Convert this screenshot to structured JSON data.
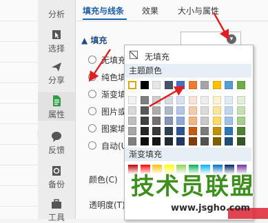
{
  "tabs": [
    {
      "label": "填充与线条",
      "active": true
    },
    {
      "label": "效果",
      "active": false
    },
    {
      "label": "大小与属性",
      "active": false
    }
  ],
  "sidebar": {
    "items": [
      {
        "label": "分析",
        "icon": "analysis-icon"
      },
      {
        "label": "选择",
        "icon": "select-cursor-icon"
      },
      {
        "label": "分享",
        "icon": "share-icon"
      },
      {
        "label": "属性",
        "icon": "properties-icon",
        "active": true
      },
      {
        "label": "反馈",
        "icon": "feedback-icon"
      },
      {
        "label": "备份",
        "icon": "backup-icon"
      },
      {
        "label": "工具",
        "icon": "toolbox-icon"
      }
    ]
  },
  "fill": {
    "section_title": "▲ 填充",
    "options": [
      {
        "label": "无填充",
        "checked": false
      },
      {
        "label": "纯色填充",
        "checked": true
      },
      {
        "label": "渐变填充",
        "checked": false
      },
      {
        "label": "图片或纹理填充",
        "checked": false
      },
      {
        "label": "图案填充",
        "checked": false
      },
      {
        "label": "自动(U)",
        "checked": false
      }
    ],
    "color_label": "颜色(C)",
    "transparency_label": "透明度(T)"
  },
  "palette": {
    "no_fill_label": "无填充",
    "theme_colors_label": "主题颜色",
    "gradient_label": "渐变填充",
    "theme_top_row": [
      "#ffffff",
      "#000000",
      "#e7e6e6",
      "#44546a",
      "#4472c4",
      "#ed7d31",
      "#a5a5a5",
      "#ffc000",
      "#5b9bd5",
      "#70ad47"
    ],
    "theme_shades": [
      [
        "#f2f2f2",
        "#7f7f7f",
        "#d0cece",
        "#d6dce4",
        "#d9e2f3",
        "#fbe4d5",
        "#ededed",
        "#fff2cc",
        "#deebf6",
        "#e2efd9"
      ],
      [
        "#d9d9d9",
        "#595959",
        "#aeabab",
        "#adb9ca",
        "#b4c6e7",
        "#f7caac",
        "#dbdbdb",
        "#fee599",
        "#bdd7ee",
        "#c5e0b3"
      ],
      [
        "#bfbfbf",
        "#404040",
        "#757070",
        "#8496b0",
        "#8eaadb",
        "#f4b183",
        "#c9c9c9",
        "#ffd965",
        "#9cc3e5",
        "#a8d08d"
      ],
      [
        "#a6a6a6",
        "#262626",
        "#3a3838",
        "#323f4f",
        "#2f5496",
        "#c55a11",
        "#7b7b7b",
        "#bf9000",
        "#2e75b5",
        "#538135"
      ],
      [
        "#808080",
        "#0d0d0d",
        "#171616",
        "#222a35",
        "#1f3864",
        "#833c0b",
        "#525252",
        "#7f6000",
        "#1f4e79",
        "#375623"
      ]
    ],
    "gradient_colors": [
      "#c00000",
      "#ff0000",
      "#ffc000",
      "#ffff00",
      "#92d050",
      "#00b050",
      "#00b0f0",
      "#0070c0",
      "#002060",
      "#7030a0"
    ]
  },
  "watermark": {
    "text": "技术员联盟",
    "url": "www.jsgho.com"
  },
  "colors": {
    "accent": "#1d5fa8",
    "arrow": "#e02020"
  }
}
